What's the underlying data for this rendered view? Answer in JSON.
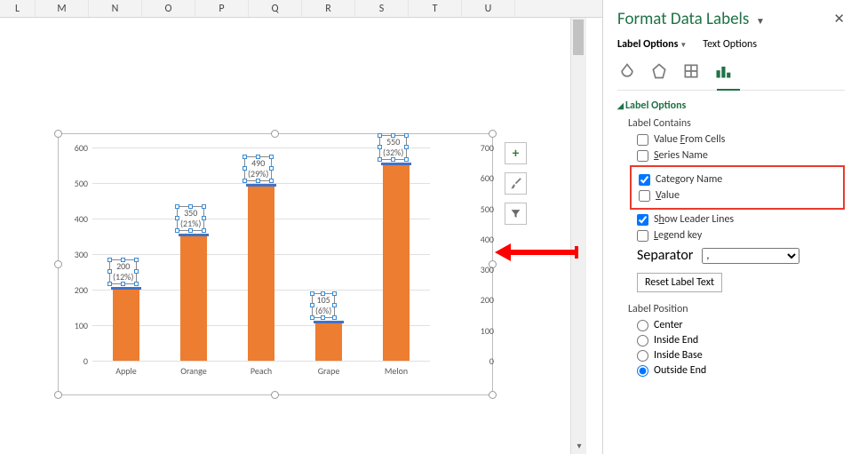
{
  "columns": [
    "L",
    "M",
    "N",
    "O",
    "P",
    "Q",
    "R",
    "S",
    "T",
    "U"
  ],
  "chart_data": {
    "type": "bar",
    "categories": [
      "Apple",
      "Orange",
      "Peach",
      "Grape",
      "Melon"
    ],
    "values": [
      200,
      350,
      490,
      105,
      550
    ],
    "percents": [
      "(12%)",
      "(21%)",
      "(29%)",
      "(6%)",
      "(32%)"
    ],
    "label_top": [
      "200",
      "350",
      "490",
      "105",
      "550"
    ],
    "ylim": [
      0,
      600
    ],
    "yticks": [
      0,
      100,
      200,
      300,
      400,
      500,
      600
    ],
    "ylim2": [
      0,
      700
    ],
    "yticks2": [
      0,
      100,
      200,
      300,
      400,
      500,
      600,
      700
    ],
    "title": "",
    "xlabel": "",
    "ylabel": ""
  },
  "chart_buttons": {
    "plus": "+",
    "brush": "brush-icon",
    "filter": "filter-icon"
  },
  "pane": {
    "title": "Format Data Labels",
    "tabs": {
      "label_options": "Label Options",
      "text_options": "Text Options"
    },
    "section": "Label Options",
    "label_contains": "Label Contains",
    "checks": {
      "value_from_cells": "Value From Cells",
      "series_name": "Series Name",
      "category_name": "Category Name",
      "value": "Value",
      "show_leader": "Show Leader Lines",
      "legend_key": "Legend key"
    },
    "checked": {
      "category_name": true,
      "show_leader": true
    },
    "separator_label": "Separator",
    "separator_value": ",",
    "reset": "Reset Label Text",
    "label_position": "Label Position",
    "radios": {
      "center": "Center",
      "inside_end": "Inside End",
      "inside_base": "Inside Base",
      "outside_end": "Outside End"
    },
    "radio_selected": "outside_end"
  }
}
